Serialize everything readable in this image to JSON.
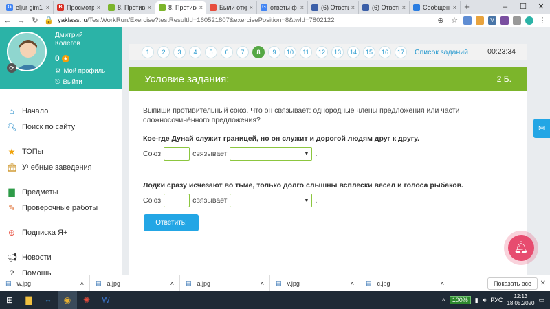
{
  "browser": {
    "tabs": [
      {
        "title": "eljur gim11",
        "fav": "G",
        "color": "#4285f4",
        "active": false
      },
      {
        "title": "Просмотр",
        "fav": "B",
        "color": "#d93025",
        "active": false
      },
      {
        "title": "8. Противо",
        "fav": "",
        "color": "#7cb52b",
        "active": false
      },
      {
        "title": "8. Противо",
        "fav": "",
        "color": "#7cb52b",
        "active": true
      },
      {
        "title": "Были откр",
        "fav": "",
        "color": "#e74c3c",
        "active": false
      },
      {
        "title": "ответы ф",
        "fav": "G",
        "color": "#4285f4",
        "active": false
      },
      {
        "title": "(6) Ответы",
        "fav": "",
        "color": "#3b5fa8",
        "active": false
      },
      {
        "title": "(6) Ответы",
        "fav": "",
        "color": "#3b5fa8",
        "active": false
      },
      {
        "title": "Сообщения",
        "fav": "",
        "color": "#2a7de1",
        "active": false
      }
    ],
    "url_domain": "yaklass.ru",
    "url_rest": "/TestWorkRun/Exercise?testResultId=160521807&exercisePosition=8&twId=7802122"
  },
  "profile": {
    "first_name": "Дмитрий",
    "last_name": "Колегов",
    "points": "0",
    "my_profile": "Мой профиль",
    "logout": "Выйти"
  },
  "nav": {
    "home": "Начало",
    "search": "Поиск по сайту",
    "tops": "ТОПы",
    "schools": "Учебные заведения",
    "subjects": "Предметы",
    "tests": "Проверочные работы",
    "subscription": "Подписка Я+",
    "news": "Новости",
    "help": "Помощь"
  },
  "exercise": {
    "numbers": [
      "1",
      "2",
      "3",
      "4",
      "5",
      "6",
      "7",
      "8",
      "9",
      "10",
      "11",
      "12",
      "13",
      "14",
      "15",
      "16",
      "17"
    ],
    "current": "8",
    "task_list": "Список заданий",
    "timer": "00:23:34",
    "title": "Условие задания:",
    "score": "2 Б.",
    "instruction": "Выпиши противительный союз. Что он связывает: однородные члены предложения или части сложносочинённого предложения?",
    "sentence1": "Кое-где Дунай служит границей, но он служит и дорогой людям друг к другу.",
    "sentence2": "Лодки сразу исчезают во тьме, только долго слышны всплески вёсел и голоса рыбаков.",
    "union_label": "Союз",
    "links_label": "связывает",
    "period": ".",
    "submit": "Ответить!"
  },
  "downloads": {
    "items": [
      "w.jpg",
      "a.jpg",
      "a.jpg",
      "v.jpg",
      "c.jpg"
    ],
    "show_all": "Показать все"
  },
  "taskbar": {
    "battery": "100%",
    "lang": "РУС",
    "time": "12:13",
    "date": "18.05.2020"
  },
  "colors": {
    "header_green": "#7cb52b",
    "accent_blue": "#23a6e5",
    "sidebar_teal": "#2bb3a7",
    "bell_pink": "#e74c6f"
  }
}
